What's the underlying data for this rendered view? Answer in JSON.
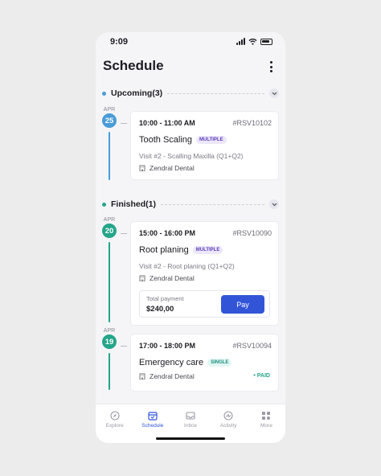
{
  "status_bar": {
    "time": "9:09"
  },
  "header": {
    "title": "Schedule"
  },
  "sections": [
    {
      "label": "Upcoming(3)",
      "color": "#4a9bd8"
    },
    {
      "label": "Finished(1)",
      "color": "#25a58a"
    }
  ],
  "appointments": [
    {
      "month": "APR",
      "day": "25",
      "color": "#4a9bd8",
      "time": "10:00 - 11:00 AM",
      "code": "#RSV10102",
      "service": "Tooth Scaling",
      "badge": "MULTIPLE",
      "visit": "Visit #2 - Scalling Maxilla (Q1+Q2)",
      "clinic": "Zendral Dental"
    },
    {
      "month": "APR",
      "day": "20",
      "color": "#25a58a",
      "time": "15:00 - 16:00 PM",
      "code": "#RSV10090",
      "service": "Root planing",
      "badge": "MULTIPLE",
      "visit": "Visit #2 - Root planing (Q1+Q2)",
      "clinic": "Zendral Dental",
      "payment": {
        "label": "Total payment",
        "amount": "$240,00",
        "button": "Pay"
      }
    },
    {
      "month": "APR",
      "day": "19",
      "color": "#25a58a",
      "time": "17:00 - 18:00 PM",
      "code": "#RSV10094",
      "service": "Emergency care",
      "badge": "SINGLE",
      "clinic": "Zendral Dental",
      "status": "• PAID"
    }
  ],
  "tabs": [
    {
      "label": "Explore",
      "icon": "compass-icon"
    },
    {
      "label": "Schedule",
      "icon": "calendar-icon",
      "active": true
    },
    {
      "label": "Inbox",
      "icon": "inbox-icon"
    },
    {
      "label": "Activity",
      "icon": "activity-icon"
    },
    {
      "label": "More",
      "icon": "grid-icon"
    }
  ],
  "colors": {
    "accent": "#3255d8",
    "upcoming": "#4a9bd8",
    "finished": "#25a58a"
  }
}
